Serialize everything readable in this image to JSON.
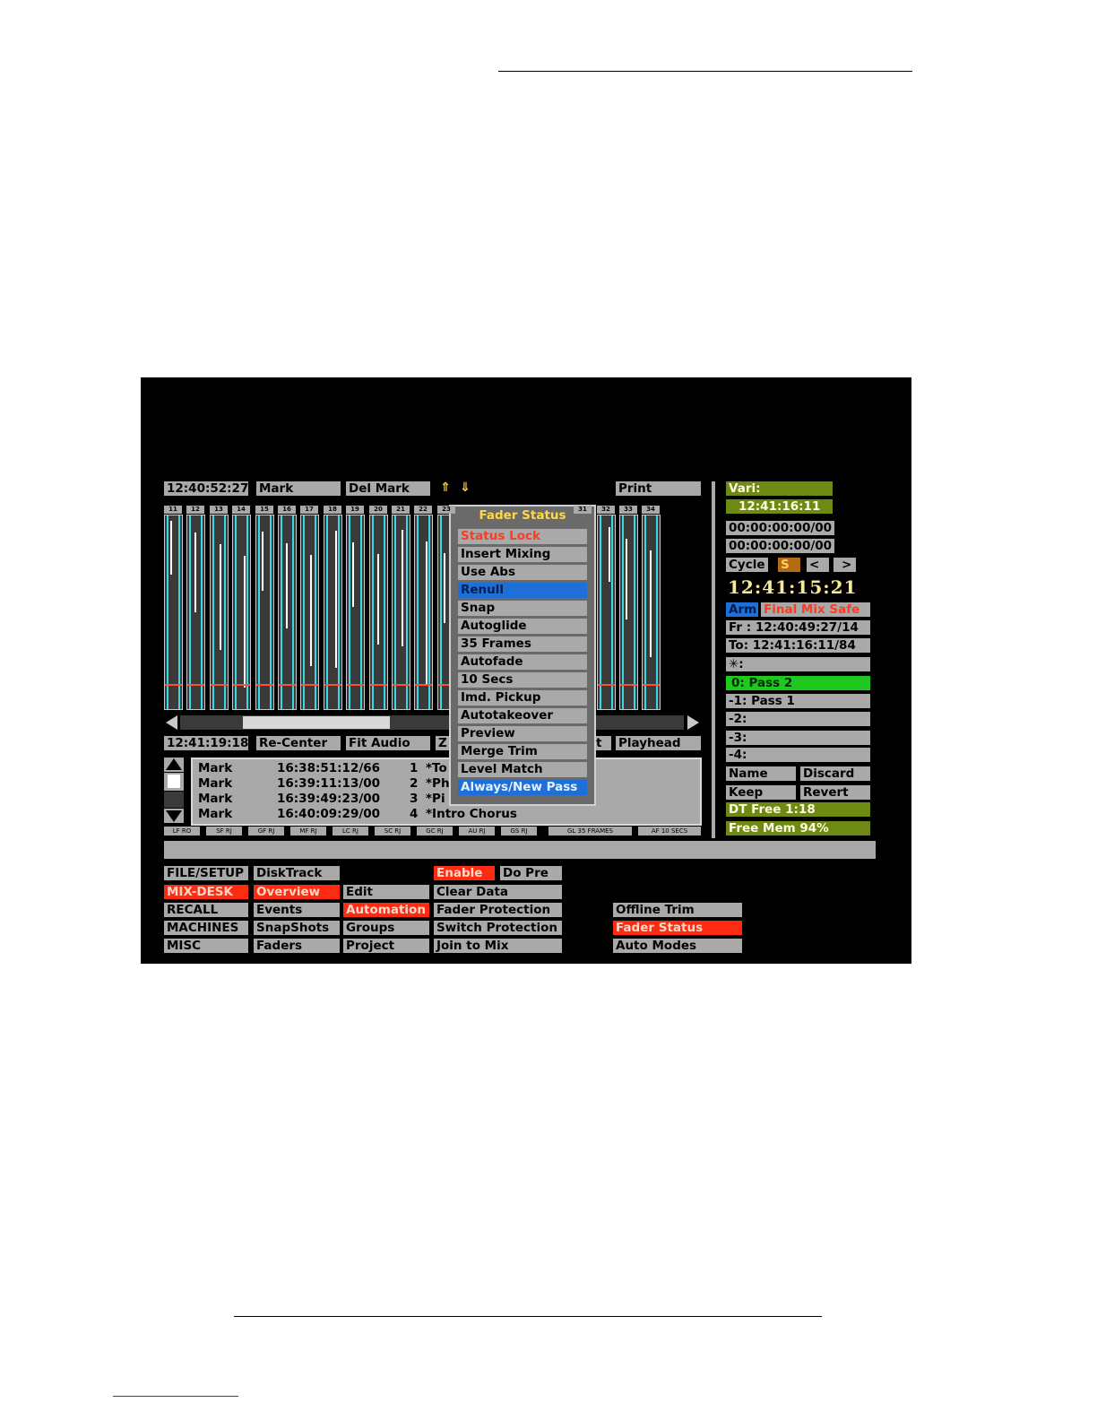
{
  "toolbar_top": {
    "timecode": "12:40:52:27",
    "mark": "Mark",
    "del_mark": "Del  Mark",
    "up_arrow": "⇑",
    "down_arrow": "⇓",
    "print": "Print"
  },
  "track_numbers": [
    "11",
    "12",
    "13",
    "14",
    "15",
    "16",
    "17",
    "18",
    "19",
    "20",
    "21",
    "22",
    "23",
    "",
    "",
    "",
    "",
    "",
    "31",
    "32",
    "33",
    "34"
  ],
  "toolbar_bottom": {
    "timecode": "12:41:19:18",
    "recenter": "Re-Center",
    "fit_audio": "Fit  Audio",
    "zoom_partial": "Z",
    "t_partial": "t",
    "playhead": "Playhead"
  },
  "fader_status_menu": {
    "title": "Fader  Status",
    "items": [
      "Status  Lock",
      "Insert  Mixing",
      "Use  Abs",
      "Renull",
      "Snap",
      "Autoglide",
      "35  Frames",
      "Autofade",
      "10  Secs",
      "Imd.  Pickup",
      "Autotakeover",
      "Preview",
      "Merge  Trim",
      "Level  Match",
      "Always/New  Pass"
    ],
    "selected": "Renull"
  },
  "marks": [
    {
      "type": "Mark",
      "time": "16:38:51:12/66",
      "index": "1",
      "name": "*To"
    },
    {
      "type": "Mark",
      "time": "16:39:11:13/00",
      "index": "2",
      "name": "*Ph"
    },
    {
      "type": "Mark",
      "time": "16:39:49:23/00",
      "index": "3",
      "name": "*Pi"
    },
    {
      "type": "Mark",
      "time": "16:40:09:29/00",
      "index": "4",
      "name": "*Intro  Chorus"
    }
  ],
  "status_strip": [
    "LF RO",
    "SF RJ",
    "GF RJ",
    "MF RJ",
    "LC RJ",
    "SC RJ",
    "GC RJ",
    "AU RJ",
    "GS RJ",
    "GL 35 FRAMES",
    "AF 10 SECS"
  ],
  "right_panel": {
    "vari": "Vari:",
    "vari_time": "12:41:16:11",
    "tc1": "00:00:00:00/00",
    "tc2": "00:00:00:00/00",
    "cycle": "Cycle",
    "s": "S",
    "prev": "<",
    "next": ">",
    "big_time": "12:41:15:21",
    "arm": "Arm",
    "final_mix_safe": "Final Mix Safe",
    "from": "Fr : 12:40:49:27/14",
    "to": "To: 12:41:16:11/84",
    "star": "✳:",
    "passes": [
      "0: Pass  2",
      "-1: Pass  1",
      "-2:",
      "-3:",
      "-4:"
    ],
    "name": "Name",
    "discard": "Discard",
    "keep": "Keep",
    "revert": "Revert",
    "dt_free": "DT  Free  1:18",
    "free_mem": "Free  Mem  94%"
  },
  "menu_grid": {
    "col1": [
      "FILE/SETUP",
      "MIX-DESK",
      "RECALL",
      "MACHINES",
      "MISC"
    ],
    "col2": [
      "DiskTrack",
      "Overview",
      "Events",
      "SnapShots",
      "Faders"
    ],
    "col3": [
      "Edit",
      "Automation",
      "Groups",
      "Project"
    ],
    "col4_enable": "Enable",
    "col4_dopre": "Do  Pre",
    "col4": [
      "Clear  Data",
      "Fader  Protection",
      "Switch  Protection",
      "Join  to  Mix"
    ],
    "col5": [
      "Offline  Trim",
      "Fader  Status",
      "Auto  Modes"
    ]
  },
  "colors": {
    "active_red": "#ff2a12",
    "highlight_blue": "#1e6fd8",
    "olive": "#6e8a12",
    "pass_green": "#1ec81e",
    "button_gray": "#a9a9a9"
  }
}
